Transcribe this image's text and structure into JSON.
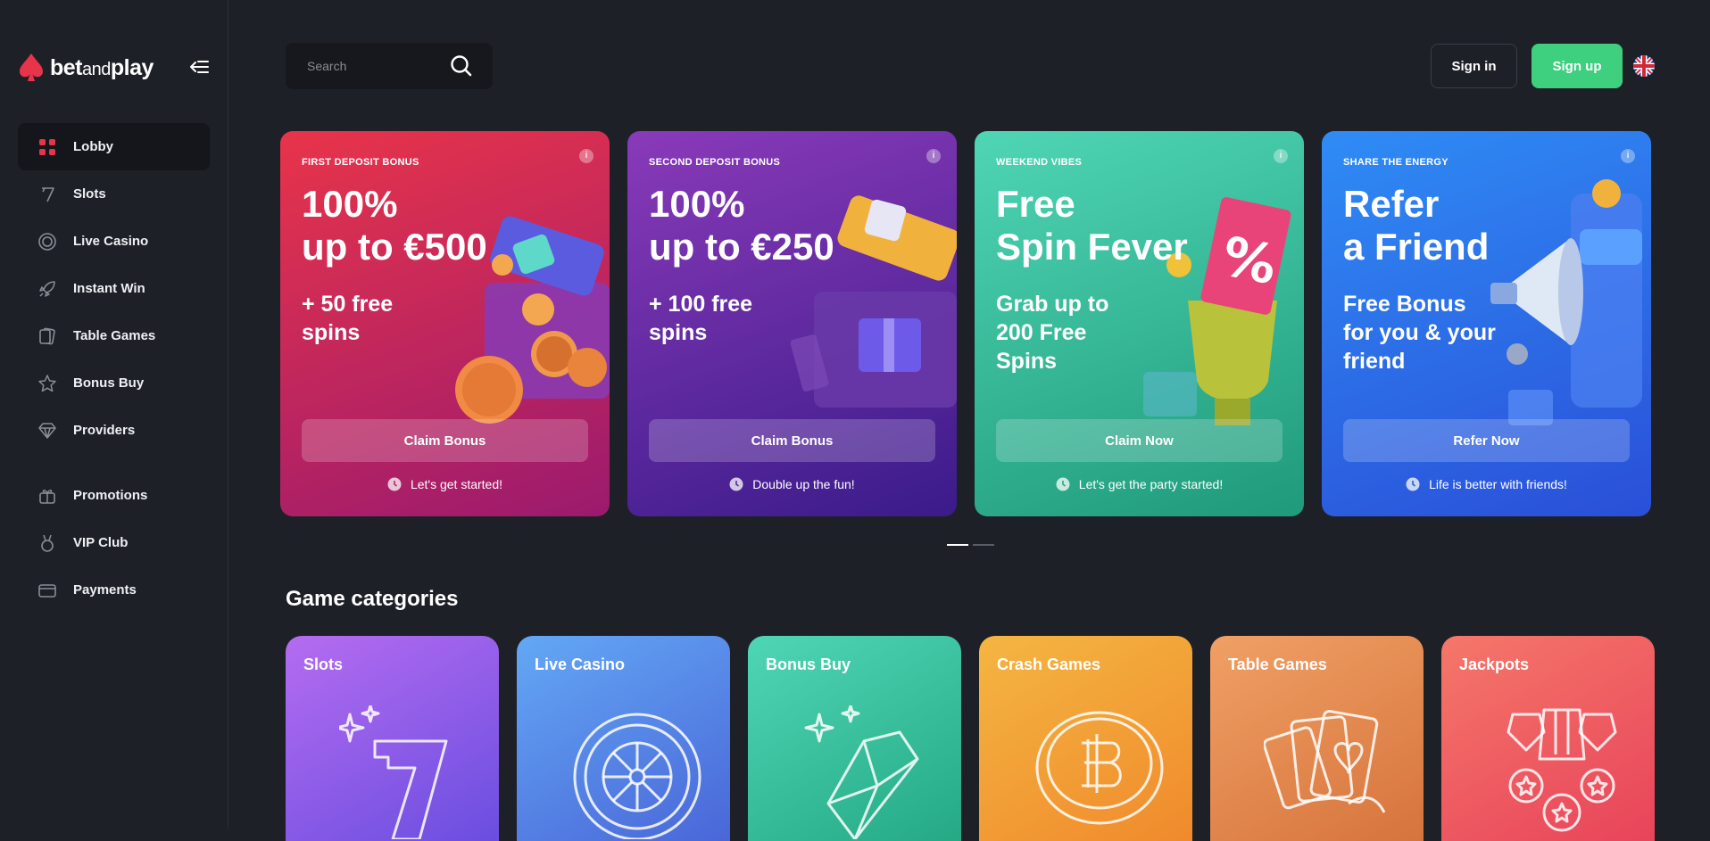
{
  "brand": {
    "name_a": "bet",
    "name_b": "and",
    "name_c": "play",
    "accent": "#e8344a"
  },
  "sidebar": {
    "items": [
      {
        "label": "Lobby",
        "icon": "grid-icon"
      },
      {
        "label": "Slots",
        "icon": "seven-icon"
      },
      {
        "label": "Live Casino",
        "icon": "roulette-icon"
      },
      {
        "label": "Instant Win",
        "icon": "rocket-icon"
      },
      {
        "label": "Table Games",
        "icon": "cards-icon"
      },
      {
        "label": "Bonus Buy",
        "icon": "star-icon"
      },
      {
        "label": "Providers",
        "icon": "diamond-icon"
      }
    ],
    "items2": [
      {
        "label": "Promotions",
        "icon": "gift-icon"
      },
      {
        "label": "VIP Club",
        "icon": "medal-icon"
      },
      {
        "label": "Payments",
        "icon": "card-icon"
      }
    ]
  },
  "header": {
    "search_placeholder": "Search",
    "signin": "Sign in",
    "signup": "Sign up",
    "signup_color": "#3ecf7f"
  },
  "promos": [
    {
      "tag": "FIRST DEPOSIT BONUS",
      "title": "100%\nup to €500",
      "sub": "+ 50 free\nspins",
      "cta": "Claim Bonus",
      "foot": "Let's get started!",
      "colors": [
        "#e8344a",
        "#9b1a6e"
      ]
    },
    {
      "tag": "SECOND DEPOSIT BONUS",
      "title": "100%\nup to €250",
      "sub": "+ 100 free\nspins",
      "cta": "Claim Bonus",
      "foot": "Double up the fun!",
      "colors": [
        "#8a3ab9",
        "#3a1b8a"
      ]
    },
    {
      "tag": "WEEKEND VIBES",
      "title": "Free\nSpin Fever",
      "sub": "Grab up to\n200 Free\nSpins",
      "cta": "Claim Now",
      "foot": "Let's get the party started!",
      "colors": [
        "#4fd6b5",
        "#1f9a7a"
      ]
    },
    {
      "tag": "SHARE THE ENERGY",
      "title": "Refer\na Friend",
      "sub": "Free Bonus\nfor you & your\nfriend",
      "cta": "Refer Now",
      "foot": "Life is better with friends!",
      "colors": [
        "#2f8cf5",
        "#2a4fd8"
      ]
    }
  ],
  "carousel": {
    "pages": 2,
    "active": 0
  },
  "categories_title": "Game categories",
  "categories": [
    {
      "label": "Slots",
      "icon": "slots-seven-icon",
      "colors": [
        "#b56cf0",
        "#6a4ee0"
      ]
    },
    {
      "label": "Live Casino",
      "icon": "roulette-wheel-icon",
      "colors": [
        "#63a8f5",
        "#4a66d8"
      ]
    },
    {
      "label": "Bonus Buy",
      "icon": "diamond-sparkle-icon",
      "colors": [
        "#4fd6b5",
        "#25a985"
      ]
    },
    {
      "label": "Crash Games",
      "icon": "bitcoin-coin-icon",
      "colors": [
        "#f4b642",
        "#f08a2c"
      ]
    },
    {
      "label": "Table Games",
      "icon": "playing-cards-icon",
      "colors": [
        "#f0a065",
        "#d6743c"
      ]
    },
    {
      "label": "Jackpots",
      "icon": "medals-icon",
      "colors": [
        "#f5776a",
        "#e8445a"
      ]
    }
  ]
}
